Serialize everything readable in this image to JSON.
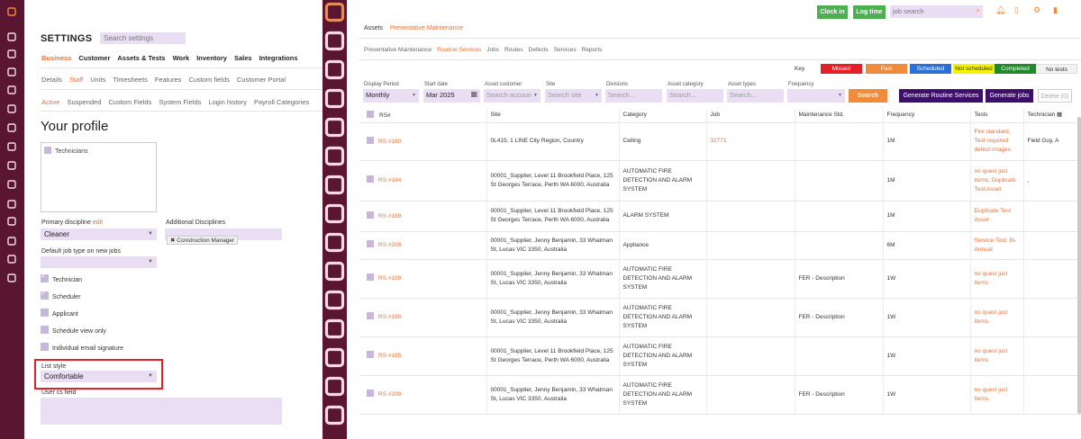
{
  "colors": {
    "sidebar": "#5a1631",
    "accent": "#e8743b",
    "lilac": "#e9def3",
    "highlight": "#e41f27",
    "green": "#4caf50",
    "purple": "#3d0f6b"
  },
  "left": {
    "title": "SETTINGS",
    "search_placeholder": "Search settings",
    "nav1": [
      "Business",
      "Customer",
      "Assets & Tests",
      "Work",
      "Inventory",
      "Sales",
      "Integrations"
    ],
    "nav2": [
      "Details",
      "Staff",
      "Units",
      "Timesheets",
      "Features",
      "Custom fields",
      "Customer Portal"
    ],
    "nav3": [
      "Active",
      "Suspended",
      "Custom Fields",
      "System Fields",
      "Login history",
      "Payroll Categories"
    ],
    "profile_title": "Your profile",
    "roles_list_item": "Technicians",
    "primary_discipline_label": "Primary discipline",
    "primary_discipline_edit": "edit",
    "primary_discipline_value": "Cleaner",
    "additional_disciplines_label": "Additional Disciplines",
    "additional_disciplines_tag": "✖ Construction Manager",
    "default_job_type_label": "Default job type on new jobs",
    "checks": [
      {
        "label": "Technician",
        "on": true
      },
      {
        "label": "Scheduler",
        "on": true
      },
      {
        "label": "Applicant",
        "on": false
      },
      {
        "label": "Schedule view only",
        "on": false
      },
      {
        "label": "Individual email signature",
        "on": false
      }
    ],
    "list_style_label": "List style",
    "list_style_value": "Comfortable",
    "user_cs_field_label": "User cs field"
  },
  "right": {
    "clock_in": "Clock in",
    "log_time": "Log time",
    "job_search_placeholder": "job search",
    "tabs_top": [
      "Assets",
      "Preventative Maintenance"
    ],
    "tabs_second": [
      "Preventative Maintenance",
      "Routine Services",
      "Jobs",
      "Routes",
      "Defects",
      "Services",
      "Reports"
    ],
    "key_label": "Key",
    "keys": [
      {
        "label": "Missed",
        "bg": "#e41f27",
        "fg": "#ffffff"
      },
      {
        "label": "Past",
        "bg": "#f08b3b",
        "fg": "#ffffff"
      },
      {
        "label": "Scheduled",
        "bg": "#2b6fd6",
        "fg": "#ffffff"
      },
      {
        "label": "Not scheduled",
        "bg": "#f7f200",
        "fg": "#333333"
      },
      {
        "label": "Completed",
        "bg": "#1f8a2a",
        "fg": "#ffffff"
      },
      {
        "label": "No tests",
        "bg": "#f2f2f2",
        "fg": "#333333"
      }
    ],
    "filters": {
      "display_period_label": "Display Period",
      "display_period_value": "Monthly",
      "start_date_label": "Start date",
      "start_date_value": "Mar 2025",
      "asset_customer_label": "Asset customer",
      "asset_customer_ph": "Search accoun",
      "site_label": "Site",
      "site_ph": "Search site",
      "divisions_label": "Divisions",
      "divisions_ph": "Search...",
      "asset_category_label": "Asset category",
      "asset_category_ph": "Search...",
      "asset_types_label": "Asset types",
      "asset_types_ph": "Search...",
      "frequency_label": "Frequency",
      "search_btn": "Search",
      "gen_routine_btn": "Generate Routine Services",
      "gen_jobs_btn": "Generate jobs",
      "delete_btn": "Delete (0)"
    },
    "columns": [
      "RS#",
      "Site",
      "Category",
      "Job",
      "Maintenance Std.",
      "Frequency",
      "Tests",
      "Technician"
    ],
    "rows": [
      {
        "rs": "RS #180",
        "site": "0L415, 1 LINE City Region, Country",
        "category": "Ceiling",
        "job": "32771",
        "std": "",
        "freq": "1M",
        "tests": "Fire standard, Test required defect images",
        "tech": "Field Guy, A"
      },
      {
        "rs": "RS #184",
        "site": "00001_Supplier, Level 11 Brookfield Place, 125 St Georges Terrace, Perth WA 6000, Australia",
        "category": "AUTOMATIC FIRE DETECTION AND ALARM SYSTEM",
        "job": "",
        "std": "",
        "freq": "1M",
        "tests": "no quest just items, Duplicate Test Asset",
        "tech": ","
      },
      {
        "rs": "RS #189",
        "site": "00001_Supplier, Level 11 Brookfield Place, 125 St Georges Terrace, Perth WA 6000, Australia",
        "category": "ALARM SYSTEM",
        "job": "",
        "std": "",
        "freq": "1M",
        "tests": "Duplicate Test Asset",
        "tech": ""
      },
      {
        "rs": "RS #208",
        "site": "00001_Supplier, Jenny Benjamin, 33 Whatman St, Lucas VIC 3350, Australia",
        "category": "Appliance",
        "job": "",
        "std": "",
        "freq": "6M",
        "tests": "Service Test: Bi-Annual",
        "tech": ""
      },
      {
        "rs": "RS #199",
        "site": "00001_Supplier, Jenny Benjamin, 33 Whatman St, Lucas VIC 3350, Australia",
        "category": "AUTOMATIC FIRE DETECTION AND ALARM SYSTEM",
        "job": "",
        "std": "FER - Description",
        "freq": "1W",
        "tests": "no quest just items",
        "tech": ""
      },
      {
        "rs": "RS #190",
        "site": "00001_Supplier, Jenny Benjamin, 33 Whatman St, Lucas VIC 3350, Australia",
        "category": "AUTOMATIC FIRE DETECTION AND ALARM SYSTEM",
        "job": "",
        "std": "FER - Description",
        "freq": "1W",
        "tests": "no quest just items",
        "tech": ""
      },
      {
        "rs": "RS #185",
        "site": "00001_Supplier, Level 11 Brookfield Place, 125 St Georges Terrace, Perth WA 6000, Australia",
        "category": "AUTOMATIC FIRE DETECTION AND ALARM SYSTEM",
        "job": "",
        "std": "",
        "freq": "1W",
        "tests": "no quest just items",
        "tech": ""
      },
      {
        "rs": "RS #209",
        "site": "00001_Supplier, Jenny Benjamin, 33 Whatman St, Lucas VIC 3350, Australia",
        "category": "AUTOMATIC FIRE DETECTION AND ALARM SYSTEM",
        "job": "",
        "std": "FER - Description",
        "freq": "1W",
        "tests": "no quest just items",
        "tech": ""
      }
    ]
  }
}
